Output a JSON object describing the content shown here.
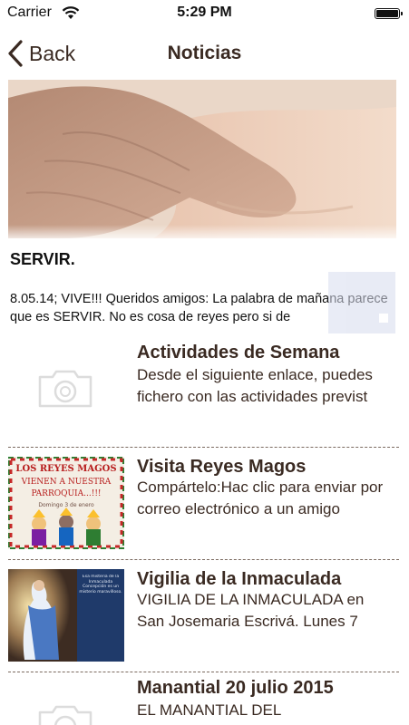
{
  "status": {
    "carrier": "Carrier",
    "time": "5:29 PM"
  },
  "nav": {
    "back_label": "Back",
    "title": "Noticias"
  },
  "featured": {
    "title": "SERVIR.",
    "text": "8.05.14; VIVE!!! Queridos amigos: La palabra de mañana parece que es SERVIR. No es cosa de reyes pero si de"
  },
  "news": [
    {
      "title": "Actividades de Semana",
      "text": "Desde el siguiente enlace, puedes fichero con las actividades previst",
      "thumb": "camera-icon"
    },
    {
      "title": "Visita Reyes Magos",
      "text": "Compártelo:Hac clic para enviar por correo electrónico a un amigo",
      "thumb": "reyes-magos-poster"
    },
    {
      "title": "Vigilia de la Inmaculada",
      "text": "VIGILIA DE LA INMACULADA en San Josemaria Escrivá. Lunes 7",
      "thumb": "inmaculada-image"
    },
    {
      "title": "Manantial 20 julio 2015",
      "text": "EL MANANTIAL DEL",
      "thumb": "camera-icon"
    }
  ],
  "reyes_poster": {
    "line1": "LOS REYES MAGOS",
    "line2": "VIENEN A NUESTRA",
    "line3": "PARROQUIA...!!!",
    "line4": "Domingo 3 de enero"
  },
  "inma_poster": {
    "text": "Esa misteria de la Inmaculada Concepción es un misterio maravilloso."
  },
  "colors": {
    "text": "#3a2a22",
    "separator": "#7b6a60"
  }
}
